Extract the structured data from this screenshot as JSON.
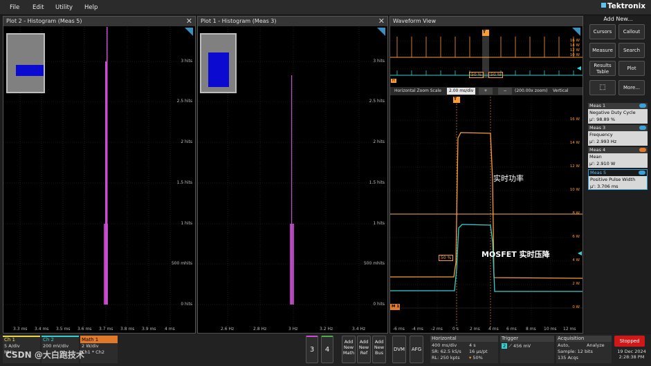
{
  "menu": {
    "file": "File",
    "edit": "Edit",
    "utility": "Utility",
    "help": "Help",
    "brand": "Tektronix"
  },
  "plot2": {
    "title": "Plot 2 - Histogram (Meas 5)",
    "y_ticks": [
      "3 hits",
      "2.5 hits",
      "2 hits",
      "1.5 hits",
      "1 hits",
      "500 mhits",
      "0 hits"
    ],
    "x_ticks": [
      "3.3 ms",
      "3.4 ms",
      "3.5 ms",
      "3.6 ms",
      "3.7 ms",
      "3.8 ms",
      "3.9 ms",
      "4 ms"
    ]
  },
  "plot1": {
    "title": "Plot 1 - Histogram (Meas 3)",
    "y_ticks": [
      "3 hits",
      "2.5 hits",
      "2 hits",
      "1.5 hits",
      "1 hits",
      "500 mhits",
      "0 hits"
    ],
    "x_ticks": [
      "2.6 Hz",
      "2.8 Hz",
      "3 Hz",
      "3.2 Hz",
      "3.4 Hz"
    ]
  },
  "waveform": {
    "title": "Waveform View",
    "overview_ticks": [
      "16 W",
      "14 W",
      "12 W",
      "10 W"
    ],
    "overview_pct_left": "50 %",
    "overview_pct_right": "50 %",
    "zoom_label": "Horizontal Zoom Scale",
    "zoom_value": "2.00 ms/div",
    "zoom_factor": "(200.00x zoom)",
    "vertical_label": "Vertical",
    "power_ticks": [
      "16 W",
      "14 W",
      "12 W",
      "10 W",
      "8 W",
      "6 W",
      "4 W",
      "2 W",
      "0 W"
    ],
    "x_ticks": [
      "-6 ms",
      "-4 ms",
      "-2 ms",
      "0 s",
      "2 ms",
      "4 ms",
      "6 ms",
      "8 ms",
      "10 ms",
      "12 ms"
    ],
    "pct_label": "50 %",
    "label_power": "实时功率",
    "label_mosfet": "MOSFET 实时压降",
    "trigger_marker": "T",
    "math_marker": "M 1",
    "hist_marker": "H"
  },
  "side": {
    "add_new": "Add New...",
    "buttons": {
      "cursors": "Cursors",
      "callout": "Callout",
      "measure": "Measure",
      "search": "Search",
      "results_table_1": "Results",
      "results_table_2": "Table",
      "plot": "Plot",
      "more": "More..."
    },
    "meas": [
      {
        "name": "Meas 1",
        "type": "Negative Duty Cycle",
        "value": "μ': 98.89 %"
      },
      {
        "name": "Meas 3",
        "type": "Frequency",
        "value": "μ': 2.993 Hz"
      },
      {
        "name": "Meas 4",
        "type": "Mean",
        "value": "μ': 2.910 W"
      },
      {
        "name": "Meas 5",
        "type": "Positive Pulse Width",
        "value": "μ': 3.706 ms"
      }
    ]
  },
  "bottom": {
    "ch1": {
      "name": "Ch 1",
      "l1": "5 A/div",
      "l2": "",
      "l3": "MHz"
    },
    "ch2": {
      "name": "Ch 2",
      "l1": "200 mV/div",
      "l2": "",
      "l3": ""
    },
    "math1": {
      "name": "Math 1",
      "l1": "2 W/div",
      "l2": "Ch1 * Ch2"
    },
    "btn3": "3",
    "btn4": "4",
    "add_math": [
      "Add",
      "New",
      "Math"
    ],
    "add_ref": [
      "Add",
      "New",
      "Ref"
    ],
    "add_bus": [
      "Add",
      "New",
      "Bus"
    ],
    "dvm": "DVM",
    "afg": "AFG",
    "horizontal": {
      "title": "Horizontal",
      "a1": "400 ms/div",
      "a2": "SR: 62.5 kS/s",
      "a3": "RL: 250 kpts",
      "b1": "4 s",
      "b2": "16 μs/pt",
      "b3": "50%"
    },
    "trigger": {
      "title": "Trigger",
      "ch": "2",
      "level": "456 mV"
    },
    "acquisition": {
      "title": "Acquisition",
      "a1": "Auto,",
      "a2": "Sample: 12 bits",
      "a3": "135 Acqs",
      "b1": "Analyze"
    },
    "stopped": "Stopped",
    "date": "19 Dec 2024",
    "time": "2:28:38 PM"
  },
  "watermark": "CSDN @大白跑技术",
  "colors": {
    "orange": "#ff9d2e",
    "cyan": "#35d0d0",
    "magenta": "#c94ed0",
    "accent_blue": "#3aa0d8",
    "math_orange": "#e07a2a"
  }
}
